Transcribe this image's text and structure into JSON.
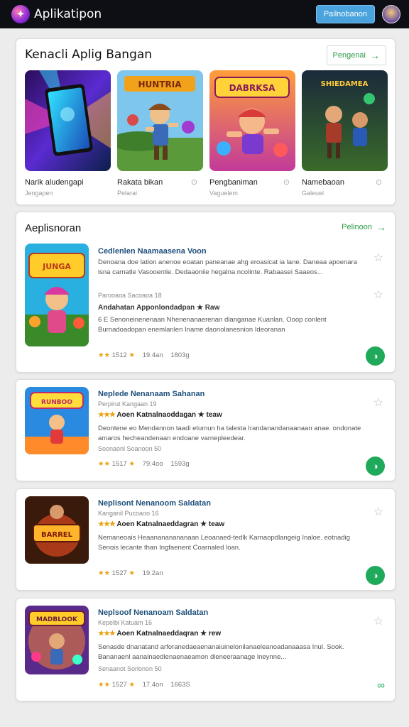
{
  "header": {
    "title": "Aplikatipon",
    "button_label": "Pailnobanon"
  },
  "featured": {
    "heading": "Kenacli Aplig Bangan",
    "link_label": "Pengenai",
    "items": [
      {
        "name": "Narik aludengapi",
        "category": "Jengapen",
        "icon": "tablet-app-art"
      },
      {
        "name": "Rakata bikan",
        "category": "Pelarai",
        "icon": "adventure-game-art"
      },
      {
        "name": "Pengbaniman",
        "category": "Vaguelem",
        "icon": "brawl-game-art"
      },
      {
        "name": "Namebaoan",
        "category": "Galeuel",
        "icon": "fighters-game-art"
      }
    ]
  },
  "apps_section": {
    "heading": "Aeplisnoran",
    "link_label": "Pelinoon",
    "items": [
      {
        "title": "Cedlenlen Naamaasena Voon",
        "desc": "Denoana doe lation anenoe eoatan paneanae ahg eroasicat ia lane. Daneaa apoenara isna carnatle Vasooentie. Dedaaoniie hegalna ncolinte. Rabaasei Saaeos...",
        "sub": "Parooaoa Sacoaoa 18",
        "title2": "Andahatan Apponlondadpan ★ Raw",
        "desc2": "6 E Senoneinenenaan Nhenenanaerenan dlanganae Kuanlan. Ooop conlent Burnadoadopan enemlanlen Iname daonolanesnion Ideoranan",
        "rating": "1512",
        "size": "19.4an",
        "downloads": "1803g",
        "art": "jungle-game-art"
      },
      {
        "title": "Neplede Nenanaam Sahanan",
        "sub": "Perpirut Kangaan 19",
        "rate_line": "Aoen Katnalnaoddagan ★ teaw",
        "desc": "Deontene eo Mendannon taadi etumun ha talesta Irandanandanaanaan anae. ondonate amaros hecheandenaan endoane varnepleedear.",
        "meta_sub": "Soonaonl Soanoon 50",
        "rating": "1517",
        "size": "79.4oo",
        "downloads": "1593g",
        "art": "runner-game-art"
      },
      {
        "title": "Neplisont Nenanoom Saldatan",
        "sub": "Kanganil Pucoaoo 16",
        "rate_line": "Aoen Katnalnaeddagran ★ teaw",
        "desc": "Nemaneoais Heaanananananaan Leoanaed-tedlk Karnaopdlangeig Inaloe. eotnadig Senois lecante than Ingfaenent Coarnaled loan.",
        "meta_sub": "",
        "rating": "1527",
        "size": "19.2an",
        "downloads": "",
        "art": "barrel-game-art"
      },
      {
        "title": "Neplsoof Nenanoam Saldatan",
        "sub": "Kepelbi Katuam 16",
        "rate_line": "Aoen Katnalnaeddaqran ★ rew",
        "desc": "Senasde dnanatand arforanedaeaenanaiuinelonilanaeleanoadanaaasa Inul. Sook. Bananaenl aanalnaedlenaenaeamon dleneeraanage lneynne...",
        "meta_sub": "Senaanot Sorlonon 50",
        "rating": "1527",
        "size": "17.4on",
        "downloads": "1663S",
        "art": "robber-game-art"
      }
    ]
  },
  "colors": {
    "accent": "#1eaa5a",
    "header_bg": "#0d0f14",
    "button_blue": "#4aa3dd",
    "title_blue": "#1d4f7a",
    "star": "#e8a20f"
  }
}
